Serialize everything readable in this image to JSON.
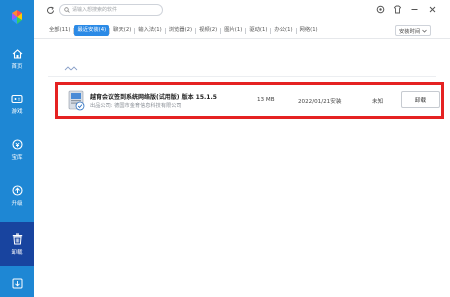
{
  "sidebar": {
    "items": [
      {
        "label": "首页",
        "icon": "home-icon"
      },
      {
        "label": "游戏",
        "icon": "gamepad-icon"
      },
      {
        "label": "宝库",
        "icon": "treasure-icon"
      },
      {
        "label": "升级",
        "icon": "upgrade-icon"
      },
      {
        "label": "卸载",
        "icon": "trash-icon"
      }
    ],
    "bottom_icon": "download-icon",
    "bg_color": "#1e87d4",
    "active_color": "#18449f"
  },
  "search": {
    "placeholder": "请输入想搜索的软件"
  },
  "tabs": [
    {
      "label": "全部(11)"
    },
    {
      "label": "最近安装(4)"
    },
    {
      "label": "聊天(2)"
    },
    {
      "label": "输入法(1)"
    },
    {
      "label": "浏览器(2)"
    },
    {
      "label": "视频(2)"
    },
    {
      "label": "图片(1)"
    },
    {
      "label": "驱动(1)"
    },
    {
      "label": "办公(1)"
    },
    {
      "label": "网络(1)"
    }
  ],
  "sort": {
    "selected": "安装时间"
  },
  "app": {
    "name": "越育会议签到系统网络版(试用版) 版本 15.1.5",
    "publisher": "出品公司: 德国市金育信息科技有限公司",
    "size": "13 MB",
    "date": "2022/01/21安装",
    "freq": "未知",
    "uninstall_label": "卸载"
  },
  "colors": {
    "accent": "#2b8ae6",
    "highlight_border": "#e52222"
  }
}
